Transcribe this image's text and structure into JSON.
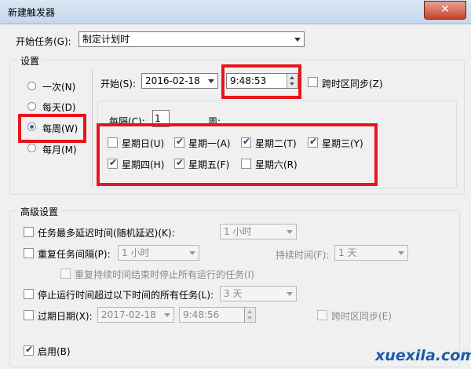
{
  "window": {
    "title": "新建触发器",
    "close_glyph": "✕"
  },
  "begin_task": {
    "label": "开始任务(G):",
    "value": "制定计划时"
  },
  "settings": {
    "legend": "设置",
    "radios": [
      {
        "label": "一次(N)",
        "selected": false
      },
      {
        "label": "每天(D)",
        "selected": false
      },
      {
        "label": "每周(W)",
        "selected": true
      },
      {
        "label": "每月(M)",
        "selected": false
      }
    ],
    "start_label": "开始(S):",
    "start_date": "2016-02-18",
    "start_time": "9:48:53",
    "sync_label": "跨时区同步(Z)",
    "every_label": "每隔(C):",
    "every_value": "1",
    "week_label": "周:",
    "days": [
      {
        "label": "星期日(U)",
        "checked": false
      },
      {
        "label": "星期一(A)",
        "checked": true
      },
      {
        "label": "星期二(T)",
        "checked": true
      },
      {
        "label": "星期三(Y)",
        "checked": true
      },
      {
        "label": "星期四(H)",
        "checked": true
      },
      {
        "label": "星期五(F)",
        "checked": true
      },
      {
        "label": "星期六(R)",
        "checked": false
      }
    ]
  },
  "advanced": {
    "legend": "高级设置",
    "delay_label": "任务最多延迟时间(随机延迟)(K):",
    "delay_value": "1 小时",
    "repeat_label": "重复任务间隔(P):",
    "repeat_value": "1 小时",
    "duration_label": "持续时间(F):",
    "duration_value": "1 天",
    "stop_running_label": "重复持续时间结束时停止所有运行的任务(I)",
    "stop_label": "停止运行时间超过以下时间的所有任务(L):",
    "stop_value": "3 天",
    "expire_label": "过期日期(X):",
    "expire_date": "2017-02-18",
    "expire_time": "9:48:56",
    "expire_sync_label": "跨时区同步(E)",
    "enabled_label": "启用(B)",
    "enabled": true
  },
  "watermark": "xuexila.com",
  "colors": {
    "highlight": "#e8141c",
    "watermark": "#1f5aa8"
  }
}
